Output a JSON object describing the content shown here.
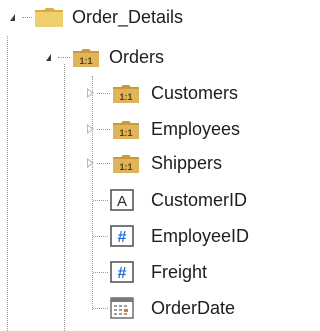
{
  "tree": {
    "root": {
      "label": "Order_Details",
      "icon": "folder-icon",
      "expanded": true
    },
    "orders": {
      "label": "Orders",
      "icon": "relation-one-to-one-icon",
      "badge": "1:1",
      "expanded": true
    },
    "children": [
      {
        "key": "customers",
        "label": "Customers",
        "icon": "relation-one-to-one-icon",
        "badge": "1:1",
        "expandable": true
      },
      {
        "key": "employees",
        "label": "Employees",
        "icon": "relation-one-to-one-icon",
        "badge": "1:1",
        "expandable": true
      },
      {
        "key": "shippers",
        "label": "Shippers",
        "icon": "relation-one-to-one-icon",
        "badge": "1:1",
        "expandable": true
      },
      {
        "key": "customerid",
        "label": "CustomerID",
        "icon": "text-field-icon",
        "glyph": "A"
      },
      {
        "key": "employeeid",
        "label": "EmployeeID",
        "icon": "number-field-icon",
        "glyph": "#"
      },
      {
        "key": "freight",
        "label": "Freight",
        "icon": "number-field-icon",
        "glyph": "#"
      },
      {
        "key": "orderdate",
        "label": "OrderDate",
        "icon": "date-field-icon"
      }
    ]
  },
  "colors": {
    "folder": "#e9c46a",
    "relation_badge": "#d9a441",
    "number_glyph": "#1f6fd1",
    "tree_lines": "#9a9a9a"
  }
}
